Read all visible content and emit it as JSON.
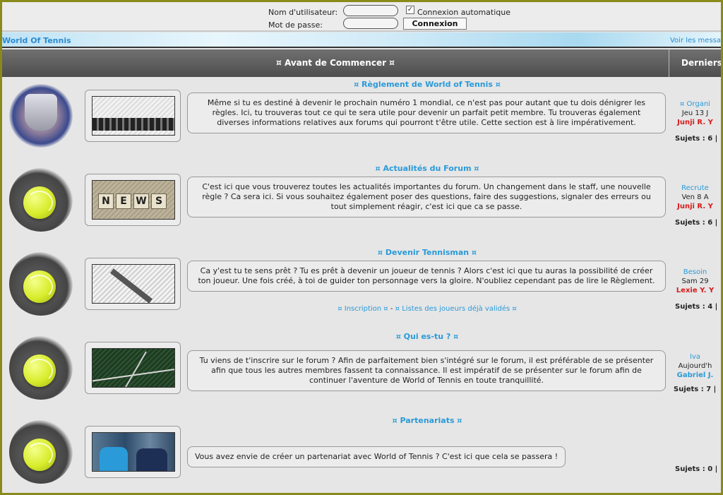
{
  "login": {
    "username_label": "Nom d'utilisateur:",
    "password_label": "Mot de passe:",
    "username_value": "",
    "password_value": "",
    "auto_check_mark": "✓",
    "auto_label": "Connexion automatique",
    "submit_label": "Connexion"
  },
  "banner": {
    "site_name": "World Of Tennis",
    "recent_link": "Voir les messa"
  },
  "header": {
    "col_forums": "¤ Avant de Commencer ¤",
    "col_last": "Derniers"
  },
  "forums": [
    {
      "title": "¤ Règlement de World of Tennis ¤",
      "description": "Même si tu es destiné à devenir le prochain numéro 1 mondial, ce n'est pas pour autant que tu dois dénigrer les règles. Ici, tu trouveras tout ce qui te sera utile pour devenir un parfait petit membre. Tu trouveras également diverses informations relatives aux forums qui pourront t'être utile. Cette section est à lire impérativement.",
      "last_topic": "¤ Organi",
      "last_date": "Jeu 13 J",
      "last_author": "Junji R. Y",
      "stats": "Sujets : 6 |"
    },
    {
      "title": "¤ Actualités du Forum ¤",
      "description": "C'est ici que vous trouverez toutes les actualités importantes du forum. Un changement dans le staff, une nouvelle règle ? Ca sera ici. Si vous souhaitez également poser des questions, faire des suggestions, signaler des erreurs ou tout simplement réagir, c'est ici que ca se passe.",
      "last_topic": "Recrute",
      "last_date": "Ven 8 A",
      "last_author": "Junji R. Y",
      "stats": "Sujets : 6 |",
      "thumb_letters": [
        "N",
        "E",
        "W",
        "S"
      ]
    },
    {
      "title": "¤ Devenir Tennisman ¤",
      "description": "Ca y'est tu te sens prêt ? Tu es prêt à devenir un joueur de tennis ? Alors c'est ici que tu auras la possibilité de créer ton joueur. Une fois créé, à toi de guider ton personnage vers la gloire. N'oubliez cependant pas de lire le Règlement.",
      "sublink_1": "¤ Inscription ¤",
      "sublink_sep": "-",
      "sublink_2": "¤ Listes des joueurs déjà validés ¤",
      "last_topic": "Besoin",
      "last_date": "Sam 29",
      "last_author": "Lexie Y. Y",
      "stats": "Sujets : 4 |"
    },
    {
      "title": "¤ Qui es-tu ? ¤",
      "description": "Tu viens de t'inscrire sur le forum ? Afin de parfaitement bien s'intégré sur le forum, il est préférable de se présenter afin que tous les autres membres fassent ta connaissance. Il est impératif de se présenter sur le forum afin de continuer l'aventure de World of Tennis en toute tranquillité.",
      "last_topic": "Iva",
      "last_date": "Aujourd'h",
      "last_author": "Gabriel J.",
      "stats": "Sujets : 7 |"
    },
    {
      "title": "¤ Partenariats ¤",
      "description": "Vous avez envie de créer un partenariat avec World of Tennis ? C'est ici que cela se passera !",
      "stats": "Sujets : 0 |"
    }
  ]
}
